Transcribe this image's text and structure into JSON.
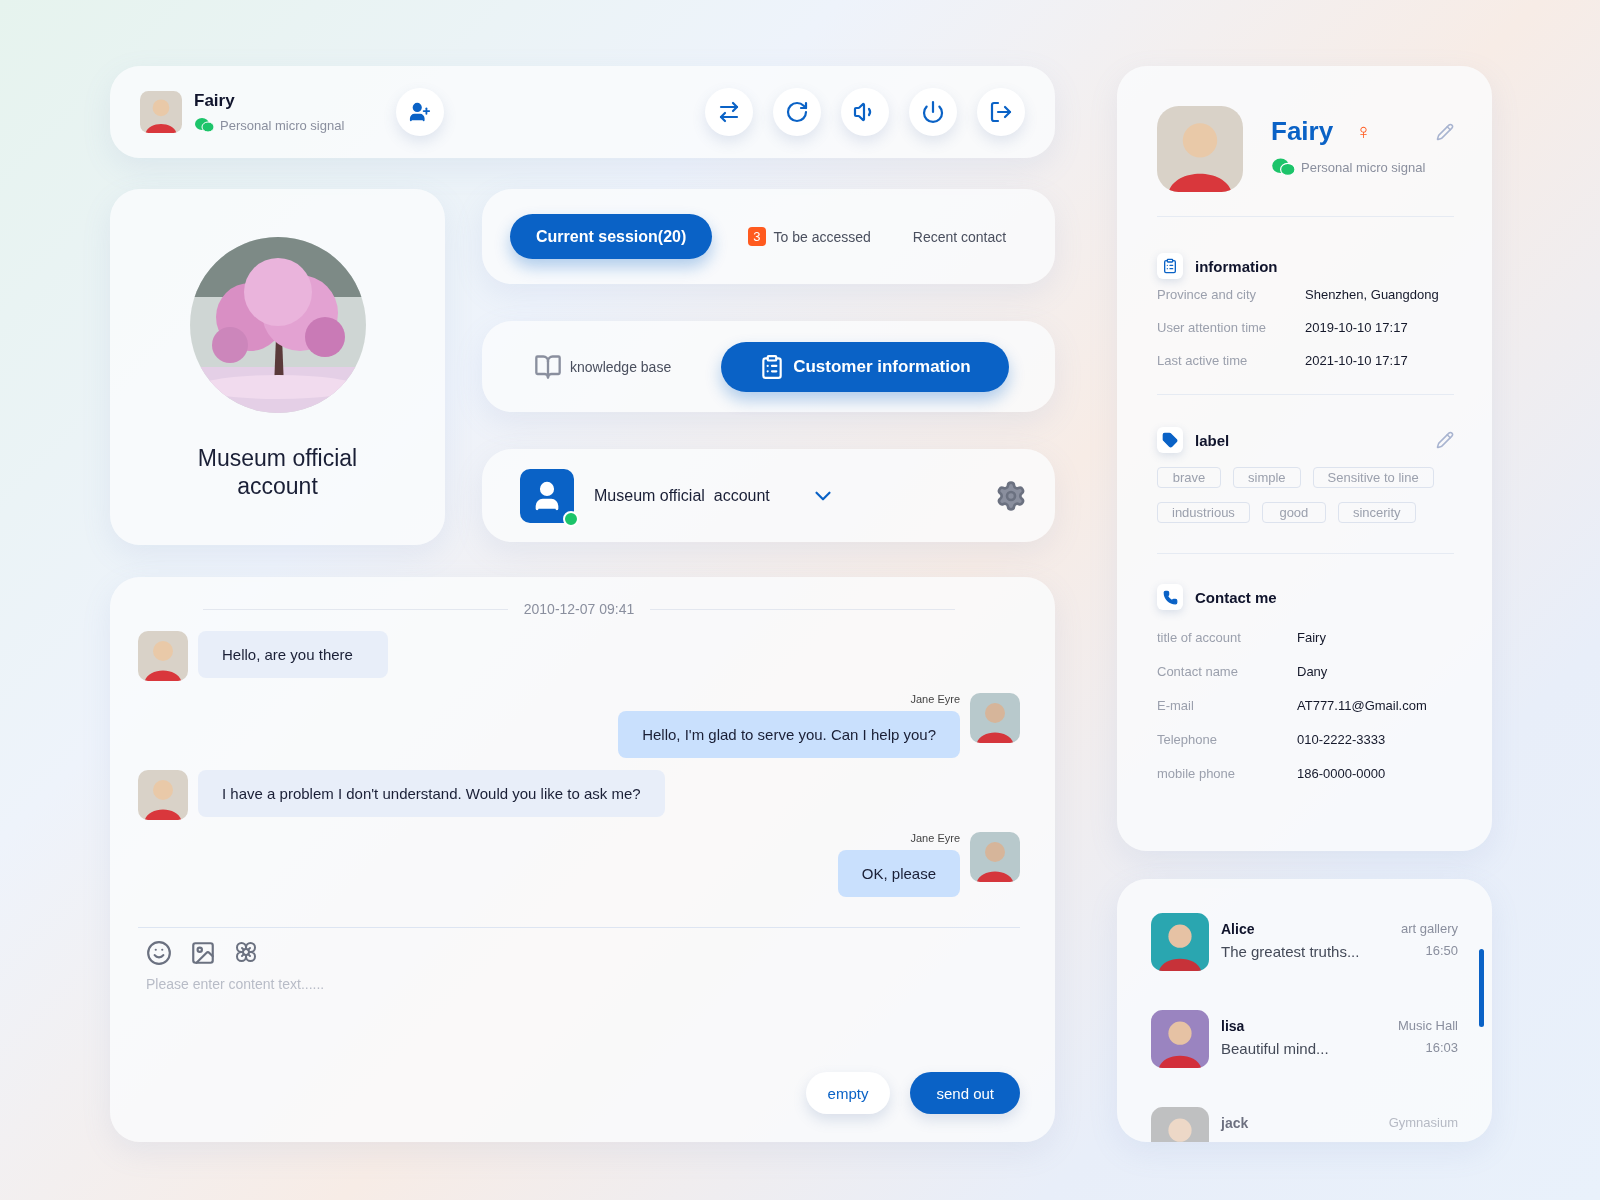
{
  "header": {
    "name": "Fairy",
    "subtitle": "Personal micro signal"
  },
  "profile_card": {
    "title": "Museum official account"
  },
  "session_tabs": [
    {
      "label": "Current session(20)",
      "selected": true
    },
    {
      "label": "To be accessed",
      "badge": "3",
      "selected": false
    },
    {
      "label": "Recent contact",
      "selected": false
    }
  ],
  "view_tabs": [
    {
      "label": "knowledge base",
      "selected": false
    },
    {
      "label": "Customer information",
      "selected": true
    }
  ],
  "account_select": {
    "value": "Museum official  account",
    "online": true
  },
  "chat": {
    "timestamp": "2010-12-07 09:41",
    "messages": [
      {
        "kind": "incoming",
        "text": "Hello, are you there"
      },
      {
        "kind": "outgoing",
        "sender": "Jane Eyre",
        "text": "Hello, I'm glad to serve you. Can I help you?"
      },
      {
        "kind": "incoming",
        "text": "I have a problem I don't understand. Would you like to ask me?"
      },
      {
        "kind": "outgoing",
        "sender": "Jane Eyre",
        "text": "OK, please"
      }
    ],
    "input": {
      "placeholder": "Please enter content text......"
    },
    "buttons": [
      {
        "label": "empty",
        "primary": false
      },
      {
        "label": "send out",
        "primary": true
      }
    ]
  },
  "customer": {
    "name": "Fairy",
    "gender_symbol": "♀",
    "subtitle": "Personal micro signal",
    "information": {
      "title": "information",
      "rows": [
        {
          "label": "Province and city",
          "value": "Shenzhen, Guangdong"
        },
        {
          "label": "User attention time",
          "value": "2019-10-10 17:17"
        },
        {
          "label": "Last active time",
          "value": "2021-10-10 17:17"
        }
      ]
    },
    "labels": {
      "title": "label",
      "tags": [
        "brave",
        "simple",
        "Sensitive to line",
        "industrious",
        "good",
        "sincerity"
      ]
    },
    "contact": {
      "title": "Contact me",
      "rows": [
        {
          "label": "title of account",
          "value": "Fairy"
        },
        {
          "label": "Contact name",
          "value": "Dany"
        },
        {
          "label": "E-mail",
          "value": "AT777.11@Gmail.com"
        },
        {
          "label": "Telephone",
          "value": "010-2222-3333"
        },
        {
          "label": "mobile phone",
          "value": "186-0000-0000"
        }
      ]
    }
  },
  "contacts": [
    {
      "name": "Alice",
      "place": "art gallery",
      "preview": "The greatest truths...",
      "time": "16:50",
      "faded": false
    },
    {
      "name": "lisa",
      "place": "Music Hall",
      "preview": "Beautiful mind...",
      "time": "16:03",
      "faded": false
    },
    {
      "name": "jack",
      "place": "Gymnasium",
      "faded": true
    }
  ]
}
